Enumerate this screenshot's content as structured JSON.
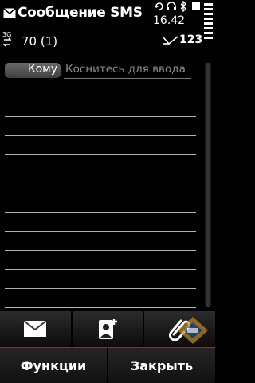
{
  "status": {
    "title": "Сообщение SMS",
    "time": "16.42",
    "network": "3G",
    "char_count": "70 (1)",
    "text_mode": "123"
  },
  "recipient": {
    "to_label": "Кому",
    "placeholder": "Коснитесь для ввода"
  },
  "toolbar": {
    "items": [
      {
        "icon": "envelope-icon"
      },
      {
        "icon": "contact-add-icon"
      },
      {
        "icon": "paperclip-icon"
      }
    ]
  },
  "softkeys": {
    "left": "Функции",
    "right": "Закрыть"
  },
  "colors": {
    "background": "#000000",
    "softkey_border": "#8a3a1a",
    "placeholder": "#8a8a8a"
  }
}
